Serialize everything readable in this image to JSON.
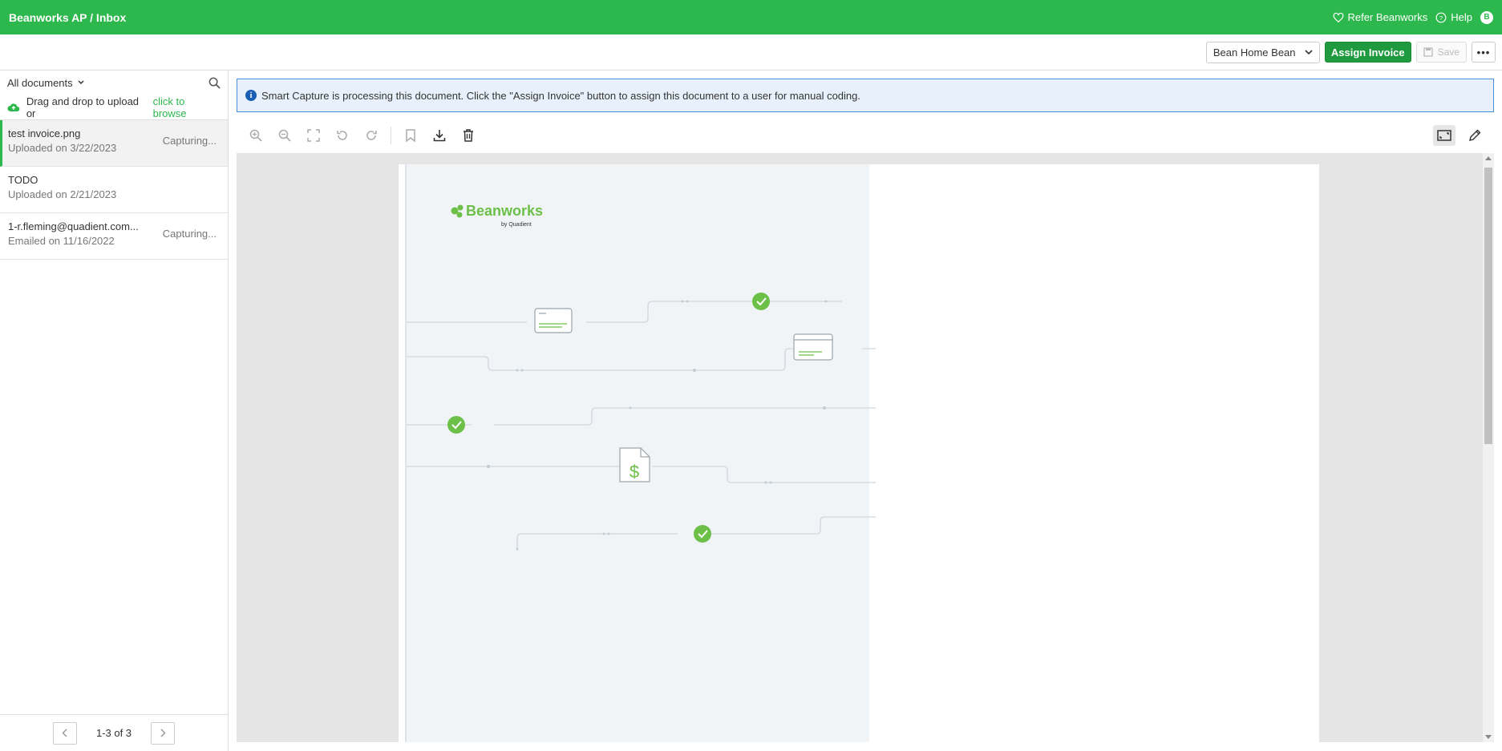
{
  "header": {
    "breadcrumb": "Beanworks AP / Inbox",
    "refer_label": "Refer Beanworks",
    "help_label": "Help",
    "avatar_initial": "B"
  },
  "actions": {
    "company": "Bean Home Bean",
    "assign_label": "Assign Invoice",
    "save_label": "Save",
    "more_label": "•••"
  },
  "sidebar": {
    "filter_label": "All documents",
    "upload_text": "Drag and drop to upload or",
    "browse_link": "click to browse",
    "documents": [
      {
        "name": "test invoice.png",
        "sub": "Uploaded on 3/22/2023",
        "status": "Capturing...",
        "active": true
      },
      {
        "name": "TODO",
        "sub": "Uploaded on 2/21/2023",
        "status": "",
        "active": false
      },
      {
        "name": "1-r.fleming@quadient.com...",
        "sub": "Emailed on 11/16/2022",
        "status": "Capturing...",
        "active": false
      }
    ],
    "pagination": "1-3 of 3"
  },
  "banner": {
    "message": "Smart Capture is processing this document. Click the \"Assign Invoice\" button to assign this document to a user for manual coding."
  },
  "document_preview": {
    "logo_text": "Beanworks",
    "logo_subtext": "by Quadient",
    "currency_symbol": "$"
  },
  "colors": {
    "brand_green": "#2db84d",
    "assign_green": "#1f9a3e",
    "banner_bg": "#e8f1fb",
    "banner_border": "#4a90d9"
  }
}
